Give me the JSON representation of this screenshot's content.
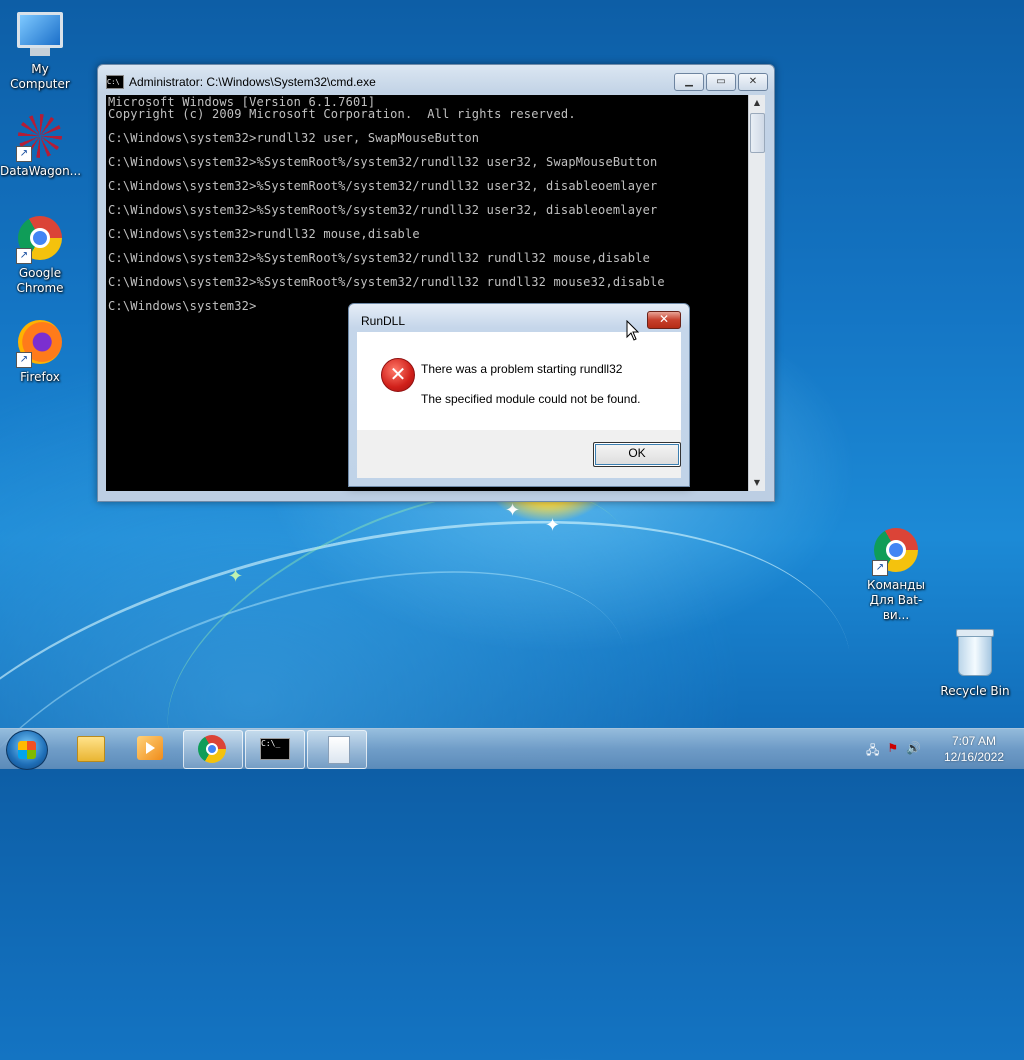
{
  "desktop": {
    "icons": [
      {
        "label": "My Computer"
      },
      {
        "label": "DataWagon..."
      },
      {
        "label": "Google Chrome"
      },
      {
        "label": "Firefox"
      },
      {
        "label": "Команды Для Bat-ви..."
      },
      {
        "label": "Recycle Bin"
      }
    ]
  },
  "cmd": {
    "title": "Administrator: C:\\Windows\\System32\\cmd.exe",
    "icon_text": "C:\\",
    "lines": "Microsoft Windows [Version 6.1.7601]\nCopyright (c) 2009 Microsoft Corporation.  All rights reserved.\n\nC:\\Windows\\system32>rundll32 user, SwapMouseButton\n\nC:\\Windows\\system32>%SystemRoot%/system32/rundll32 user32, SwapMouseButton\n\nC:\\Windows\\system32>%SystemRoot%/system32/rundll32 user32, disableoemlayer\n\nC:\\Windows\\system32>%SystemRoot%/system32/rundll32 user32, disableoemlayer\n\nC:\\Windows\\system32>rundll32 mouse,disable\n\nC:\\Windows\\system32>%SystemRoot%/system32/rundll32 rundll32 mouse,disable\n\nC:\\Windows\\system32>%SystemRoot%/system32/rundll32 rundll32 mouse32,disable\n\nC:\\Windows\\system32>"
  },
  "dialog": {
    "title": "RunDLL",
    "close_symbol": "✕",
    "message_1": "There was a problem starting rundll32",
    "message_2": "The specified module could not be found.",
    "ok_label": "OK"
  },
  "taskbar": {
    "cmd_icon_text": "C:\\_",
    "clock_time": "7:07 AM",
    "clock_date": "12/16/2022"
  }
}
